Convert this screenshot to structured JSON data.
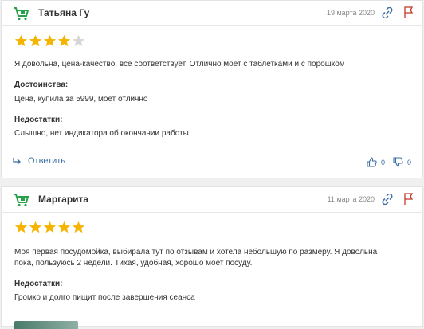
{
  "reviews": [
    {
      "author": "Татьяна Гу",
      "date": "19 марта 2020",
      "rating": 4,
      "max_rating": 5,
      "body": "Я довольна, цена-качество, все соответствует. Отлично моет с таблетками и с порошком",
      "pros_label": "Достоинства:",
      "pros_text": "Цена, купила за 5999, моет отлично",
      "cons_label": "Недостатки:",
      "cons_text": "Слышно, нет индикатора об окончании работы",
      "reply_label": "Ответить",
      "likes": "0",
      "dislikes": "0"
    },
    {
      "author": "Маргарита",
      "date": "11 марта 2020",
      "rating": 5,
      "max_rating": 5,
      "body_line1": "Моя первая посудомойка, выбирала тут по отзывам и хотела небольшую по размеру. Я довольна",
      "body_line2": "пока, пользуюсь 2 недели. Тихая, удобная, хорошо моет посуду.",
      "cons_label": "Недостатки:",
      "cons_text": "Громко и долго пищит после завершения сеанса"
    }
  ],
  "colors": {
    "star_filled": "#f5b400",
    "star_empty": "#d6d6d6",
    "brand_green": "#27a04a",
    "link_blue": "#3a6ea5"
  },
  "icons": [
    "cart-avatar-icon",
    "share-icon",
    "report-icon",
    "star-icon",
    "reply-arrow-icon",
    "thumbs-up-icon",
    "thumbs-down-icon"
  ]
}
